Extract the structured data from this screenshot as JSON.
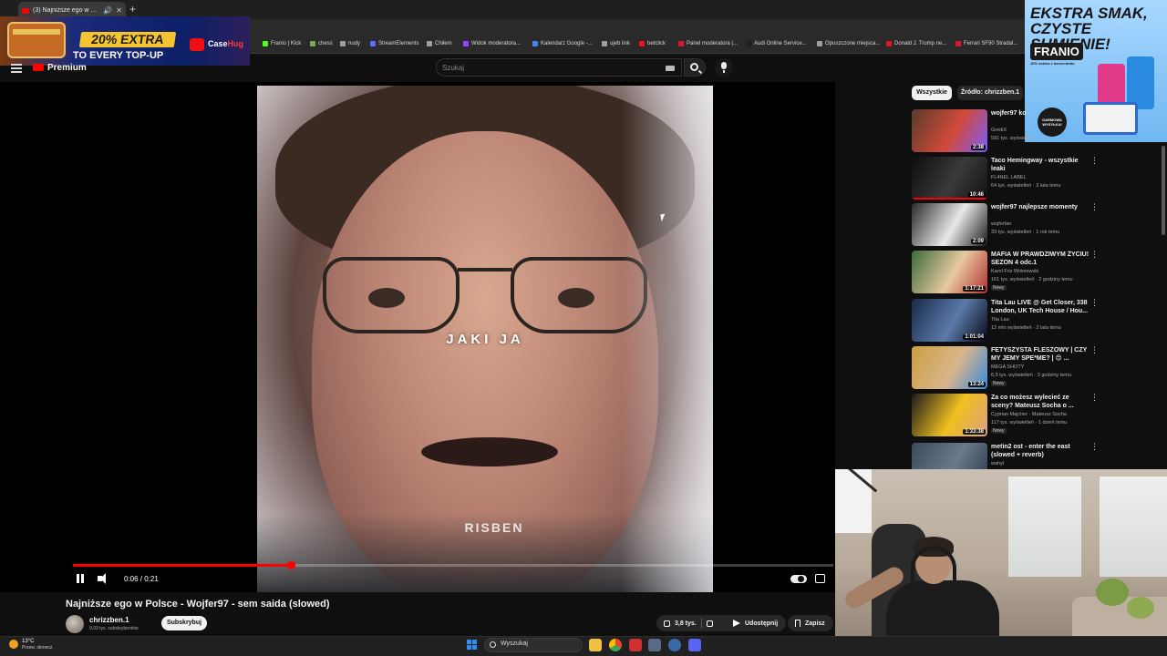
{
  "browser": {
    "tab_title": "(3) Najniższe ego w Polsce",
    "tab_close": "✕",
    "new_tab": "+",
    "bookmarks": [
      {
        "label": "Franio | Kick",
        "color": "#53fc18"
      },
      {
        "label": "chess",
        "color": "#7fa650"
      },
      {
        "label": "nudy",
        "color": "#9aa0a6"
      },
      {
        "label": "StreamElements",
        "color": "#5b6cff"
      },
      {
        "label": "Chiłem",
        "color": "#9aa0a6"
      },
      {
        "label": "Widok moderatora...",
        "color": "#9146ff"
      },
      {
        "label": "Kalendarz Google -...",
        "color": "#4285f4"
      },
      {
        "label": "ujeb link",
        "color": "#9aa0a6"
      },
      {
        "label": "betclick",
        "color": "#e8112d"
      },
      {
        "label": "Panel moderatora |...",
        "color": "#e8112d"
      },
      {
        "label": "Audi Online Service...",
        "color": "#222222"
      },
      {
        "label": "Opuszczone miejsca...",
        "color": "#9aa0a6"
      },
      {
        "label": "Donald J. Trump ne...",
        "color": "#e8112d"
      },
      {
        "label": "Ferrari SF90 Stradal...",
        "color": "#e8112d"
      }
    ]
  },
  "ads": {
    "left": {
      "headline": "20% EXTRA",
      "sub": "TO EVERY TOP-UP",
      "brand_a": "Case",
      "brand_b": "Hug"
    },
    "right": {
      "headline": "EKSTRA SMAK, CZYSTE SUMIENIE!",
      "brand": "FRANIO",
      "note": "10% soków z koncentratu",
      "badge": "DARMOWA WYSYŁKA!"
    }
  },
  "youtube": {
    "premium_label": "Premium",
    "search_placeholder": "Szukaj",
    "video": {
      "caption_main": "JAKI JA",
      "caption_sub": "RISBEN",
      "time": "0:06 / 0:21",
      "progress": 0.286,
      "title": "Najniższe ego w Polsce - Wojfer97 - sem saida (slowed)"
    },
    "channel": {
      "name": "chrizzben.1",
      "subs": "9,03 tys. subskrybentów",
      "subscribe": "Subskrybuj"
    },
    "actions": {
      "likes": "3,8 tys.",
      "share": "Udostępnij",
      "save": "Zapisz"
    },
    "chips": {
      "all": "Wszystkie",
      "source": "Źródło: chrizzben.1"
    },
    "recommendations": [
      {
        "title": "wojfer97 ko",
        "channel": "GrediX",
        "meta": "591 tys. wyświetleń",
        "duration": "2:38",
        "colors": [
          "#5a3a2a",
          "#d14a3a",
          "#7a5cff"
        ],
        "progress": 0,
        "badge": ""
      },
      {
        "title": "Taco Hemingway - wszystkie leaki",
        "channel": "FL4NEL LABEL",
        "meta": "64 tys. wyświetleń · 3 lata temu",
        "duration": "10:46",
        "colors": [
          "#0d0d0d",
          "#3a3a3a",
          "#111111"
        ],
        "progress": 1,
        "badge": ""
      },
      {
        "title": "wojfer97 najlepsze momenty",
        "channel": "wojferfan",
        "meta": "33 tys. wyświetleń · 1 rok temu",
        "duration": "2:09",
        "colors": [
          "#2a2a2a",
          "#e8e8e8",
          "#1a1a1a"
        ],
        "progress": 0,
        "badge": ""
      },
      {
        "title": "MAFIA W PRAWDZIWYM ŻYCIU! SEZON 4 odc.1",
        "channel": "Karol Friz Wiśniewski",
        "meta": "161 tys. wyświetleń · 2 godziny temu",
        "duration": "1:17:21",
        "colors": [
          "#3a6a3a",
          "#e8c9a0",
          "#b03030"
        ],
        "progress": 0,
        "badge": "Nowy"
      },
      {
        "title": "Tita Lau LIVE @ Get Closer, 338 London, UK Tech House / Hou...",
        "channel": "Tita Lau",
        "meta": "12 mln wyświetleń · 2 lata temu",
        "duration": "1:01:04",
        "colors": [
          "#1a2a4a",
          "#5a7aaa",
          "#0a0a1a"
        ],
        "progress": 0,
        "badge": ""
      },
      {
        "title": "FETYSZYSTA FLESZOWY | CZY MY JEMY SPE*ME? | 😍 ...",
        "channel": "MEGA SHOTY",
        "meta": "6,5 tys. wyświetleń · 3 godziny temu",
        "duration": "13:24",
        "colors": [
          "#c9a040",
          "#d9b58a",
          "#3a8ae0"
        ],
        "progress": 0,
        "badge": "Nowy"
      },
      {
        "title": "Za co możesz wylecieć ze sceny? Mateusz Socha o ...",
        "channel": "Cyprian Majcher · Mateusz Socha",
        "meta": "117 tys. wyświetleń · 1 dzień temu",
        "duration": "1:33:38",
        "colors": [
          "#1a1a1a",
          "#f0c020",
          "#d9a080"
        ],
        "progress": 0,
        "badge": "Nowy"
      },
      {
        "title": "metin2 ost - enter the east (slowed + reverb)",
        "channel": "wahyl",
        "meta": "",
        "duration": "",
        "colors": [
          "#3a4a5a",
          "#6a7a8a",
          "#2a3a4a"
        ],
        "progress": 0,
        "badge": ""
      }
    ]
  },
  "taskbar": {
    "temp": "13°C",
    "weather": "Przew. słonecz.",
    "search": "Wyszukaj"
  }
}
